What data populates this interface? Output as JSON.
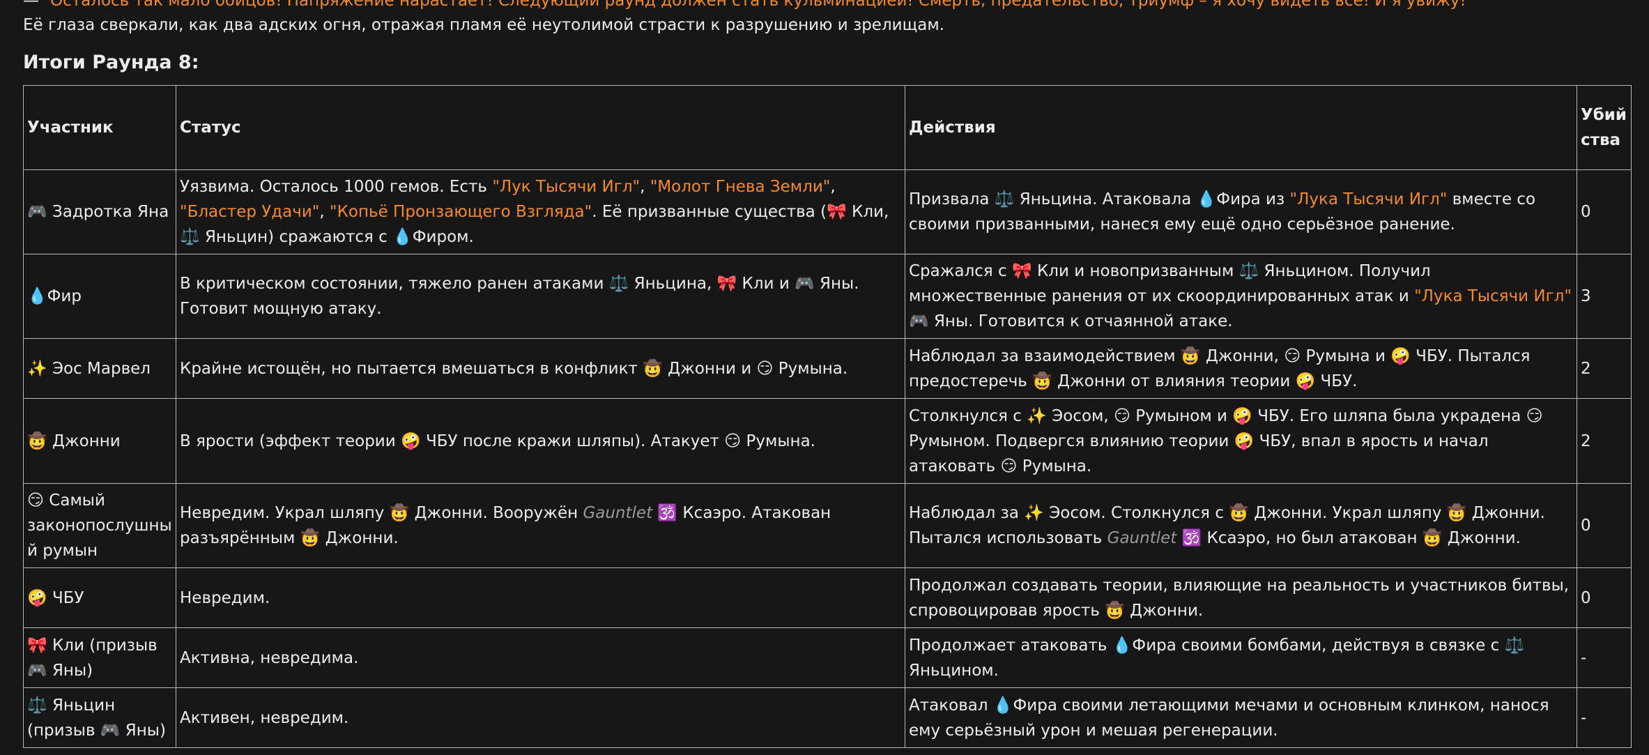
{
  "intro": {
    "line1_dash": "—",
    "line1": "Осталось так мало бойцов! Напряжение нарастает! Следующий раунд должен стать кульминацией! Смерть, предательство, триумф – я хочу видеть всё! И я увижу!",
    "line2": "Её глаза сверкали, как два адских огня, отражая пламя её неутолимой страсти к разрушению и зрелищам."
  },
  "heading": "Итоги Раунда 8:",
  "table": {
    "headers": {
      "participant": "Участник",
      "status": "Статус",
      "actions": "Действия",
      "kills": "Убийства"
    },
    "rows": [
      {
        "participant": "🎮 Задротка Яна",
        "kills": "0"
      },
      {
        "participant": "💧Фир",
        "kills": "3"
      },
      {
        "participant": "✨ Эос Марвел",
        "kills": "2"
      },
      {
        "participant": "🤠 Джонни",
        "kills": "2"
      },
      {
        "participant": "😏 Самый законопослушный румын",
        "kills": "0"
      },
      {
        "participant": "🤪 ЧБУ",
        "kills": "0"
      },
      {
        "participant": "🎀 Кли (призыв 🎮 Яны)",
        "kills": "-"
      },
      {
        "participant": "⚖️ Яньцин (призыв 🎮 Яны)",
        "kills": "-"
      }
    ],
    "texts": {
      "r0_status_a": "Уязвима. Осталось 1000 гемов. Есть ",
      "r0_status_w1": "\"Лук Тысячи Игл\"",
      "r0_status_c1": ", ",
      "r0_status_w2": "\"Молот Гнева Земли\"",
      "r0_status_c2": ", ",
      "r0_status_w3": "\"Бластер Удачи\"",
      "r0_status_c3": ", ",
      "r0_status_w4": "\"Копьё Пронзающего Взгляда\"",
      "r0_status_b": ". Её призванные существа (🎀 Кли, ⚖️ Яньцин) сражаются с 💧Фиром.",
      "r0_actions_a": "Призвала ⚖️ Яньцина. Атаковала 💧Фира из ",
      "r0_actions_w": "\"Лука Тысячи Игл\"",
      "r0_actions_b": " вместе со своими призванными, нанеся ему ещё одно серьёзное ранение.",
      "r1_status": "В критическом состоянии, тяжело ранен атаками ⚖️ Яньцина, 🎀 Кли и 🎮 Яны. Готовит мощную атаку.",
      "r1_actions_a": "Сражался с 🎀 Кли и новопризванным ⚖️ Яньцином. Получил множественные ранения от их скоординированных атак и ",
      "r1_actions_w": "\"Лука Тысячи Игл\"",
      "r1_actions_b": " 🎮 Яны. Готовится к отчаянной атаке.",
      "r2_status": "Крайне истощён, но пытается вмешаться в конфликт 🤠 Джонни и 😏 Румына.",
      "r2_actions": "Наблюдал за взаимодействием 🤠 Джонни, 😏 Румына и 🤪 ЧБУ. Пытался предостеречь 🤠 Джонни от влияния теории 🤪 ЧБУ.",
      "r3_status": "В ярости (эффект теории 🤪 ЧБУ после кражи шляпы). Атакует 😏 Румына.",
      "r3_actions": "Столкнулся с ✨ Эосом, 😏 Румыном и 🤪 ЧБУ. Его шляпа была украдена 😏 Румыном. Подвергся влиянию теории 🤪 ЧБУ, впал в ярость и начал атаковать 😏 Румына.",
      "r4_status_a": "Невредим. Украл шляпу 🤠 Джонни. Вооружён ",
      "r4_status_g": "Gauntlet",
      "r4_status_b": " 🕉️ Ксаэро. Атакован разъярённым 🤠 Джонни.",
      "r4_actions_a": "Наблюдал за ✨ Эосом. Столкнулся с 🤠 Джонни. Украл шляпу 🤠 Джонни. Пытался использовать ",
      "r4_actions_g": "Gauntlet",
      "r4_actions_b": " 🕉️ Ксаэро, но был атакован 🤠 Джонни.",
      "r5_status": "Невредим.",
      "r5_actions": "Продолжал создавать теории, влияющие на реальность и участников битвы, спровоцировав ярость 🤠 Джонни.",
      "r6_status": "Активна, невредима.",
      "r6_actions": "Продолжает атаковать 💧Фира своими бомбами, действуя в связке с ⚖️ Яньцином.",
      "r7_status": "Активен, невредим.",
      "r7_actions": "Атаковал 💧Фира своими летающими мечами и основным клинком, нанося ему серьёзный урон и мешая регенерации."
    }
  }
}
